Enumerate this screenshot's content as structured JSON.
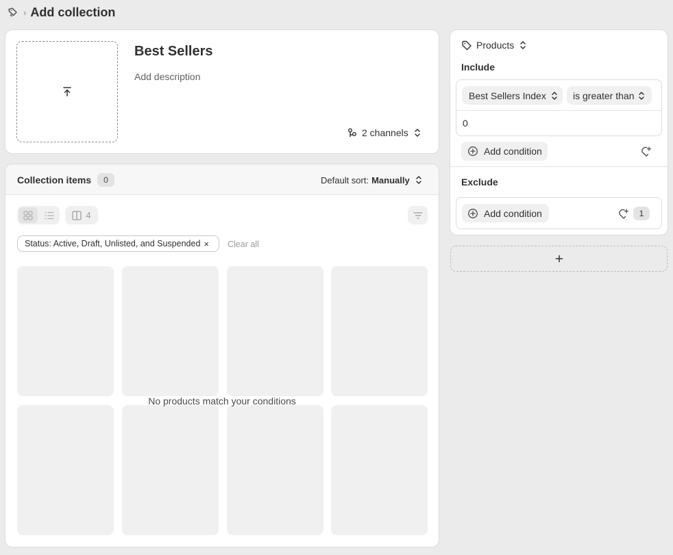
{
  "breadcrumb": {
    "title": "Add collection"
  },
  "collection": {
    "name": "Best Sellers",
    "description_placeholder": "Add description",
    "channels_label": "2 channels"
  },
  "items": {
    "title": "Collection items",
    "count": "0",
    "sort_prefix": "Default sort:",
    "sort_value": "Manually",
    "columns": "4",
    "filter_chip": "Status: Active, Draft, Unlisted, and Suspended",
    "clear_all": "Clear all",
    "empty_text": "No products match your conditions"
  },
  "rules": {
    "products_label": "Products",
    "include_label": "Include",
    "field": "Best Sellers Index",
    "operator": "is greater than",
    "value": "0",
    "add_condition": "Add condition",
    "exclude_label": "Exclude",
    "exclude_add_condition": "Add condition",
    "exclude_count": "1"
  }
}
